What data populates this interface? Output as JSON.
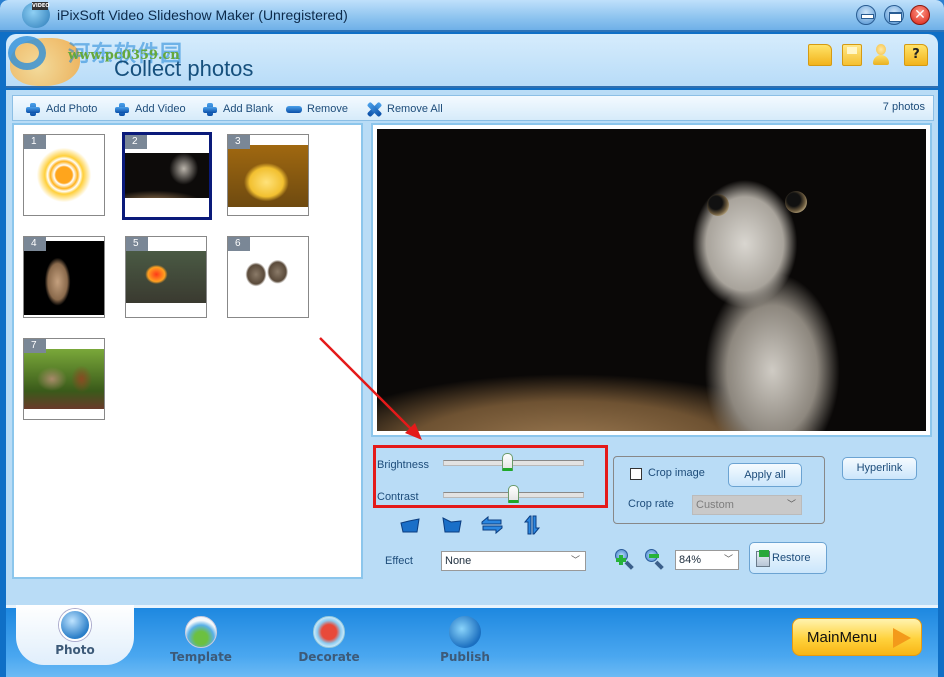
{
  "window": {
    "title": "iPixSoft Video Slideshow Maker (Unregistered)",
    "icon_tag": "VIDEO",
    "controls": {
      "minimize": "minimize-icon",
      "maximize": "maximize-icon",
      "close": "close-icon"
    }
  },
  "watermark": {
    "cn": "河东软件园",
    "url": "www.pc0359.cn"
  },
  "header": {
    "page_title": "Collect photos",
    "icons": [
      "open-folder-icon",
      "save-icon",
      "user-icon",
      "help-icon"
    ],
    "help_glyph": "?"
  },
  "toolbar": {
    "buttons": [
      {
        "label": "Add Photo",
        "icon": "add-icon"
      },
      {
        "label": "Add Video",
        "icon": "add-icon"
      },
      {
        "label": "Add Blank",
        "icon": "add-icon"
      },
      {
        "label": "Remove",
        "icon": "remove-icon"
      },
      {
        "label": "Remove All",
        "icon": "remove-all-icon"
      }
    ],
    "photo_count": "7 photos"
  },
  "photos": [
    {
      "num": "1",
      "subject": "sun drawing",
      "selected": false
    },
    {
      "num": "2",
      "subject": "kitten",
      "selected": true
    },
    {
      "num": "3",
      "subject": "duckling",
      "selected": false
    },
    {
      "num": "4",
      "subject": "cheetah cub",
      "selected": false
    },
    {
      "num": "5",
      "subject": "golden pheasant",
      "selected": false
    },
    {
      "num": "6",
      "subject": "two kittens",
      "selected": false
    },
    {
      "num": "7",
      "subject": "squirrel",
      "selected": false
    }
  ],
  "adjust": {
    "brightness_label": "Brightness",
    "brightness_value": 0.46,
    "contrast_label": "Contrast",
    "contrast_value": 0.5,
    "rotate_buttons": [
      "rotate-left-icon",
      "rotate-right-icon",
      "flip-horizontal-icon",
      "flip-vertical-icon"
    ],
    "effect_label": "Effect",
    "effect_value": "None"
  },
  "crop": {
    "checkbox_label": "Crop image",
    "checked": false,
    "apply_all": "Apply all",
    "rate_label": "Crop rate",
    "rate_value": "Custom"
  },
  "hyperlink_label": "Hyperlink",
  "zoom": {
    "value": "84%",
    "restore_label": "Restore"
  },
  "nav": {
    "tabs": [
      {
        "label": "Photo",
        "active": true
      },
      {
        "label": "Template",
        "active": false
      },
      {
        "label": "Decorate",
        "active": false
      },
      {
        "label": "Publish",
        "active": false
      }
    ],
    "main_menu": "MainMenu"
  },
  "colors": {
    "accent": "#0f6fc6",
    "panel": "#b9dcf6",
    "highlight": "#e41a1a",
    "selected_border": "#0a1a7a"
  }
}
